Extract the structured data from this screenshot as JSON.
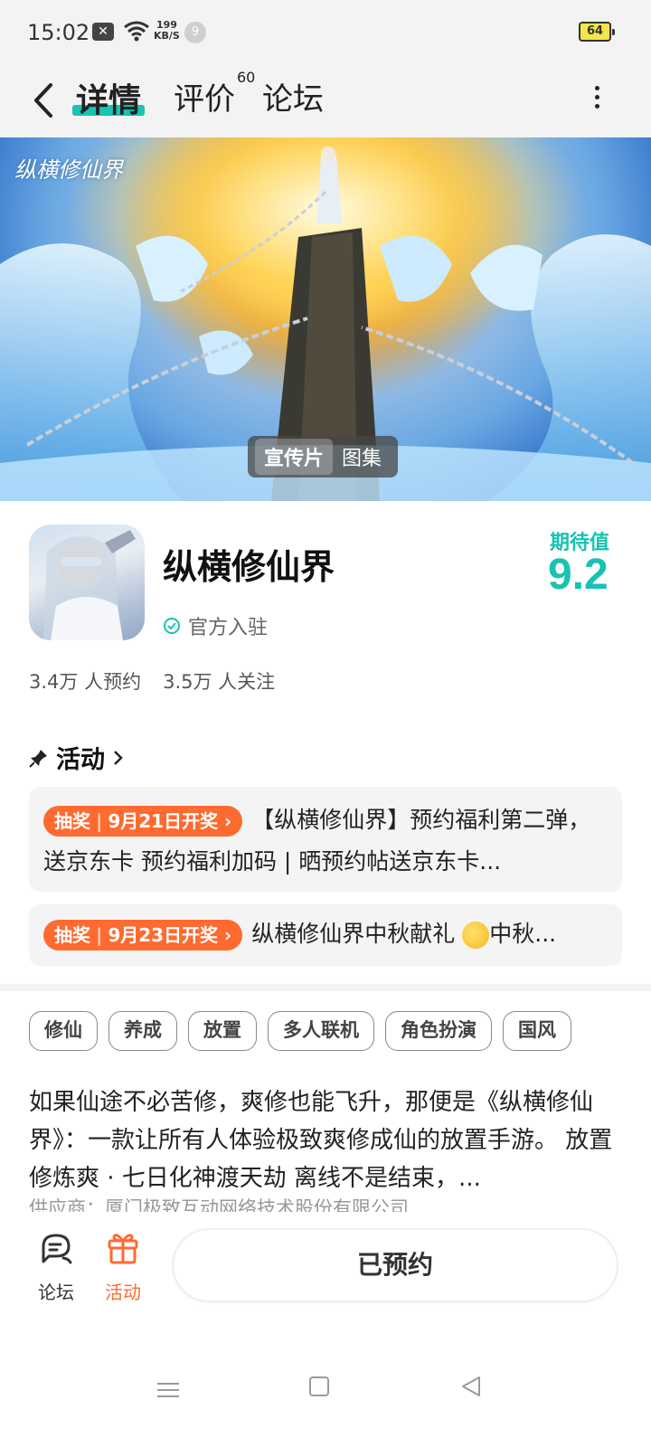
{
  "status_bar": {
    "time": "15:02",
    "net_speed_value": "199",
    "net_speed_unit": "KB/S",
    "notification_count": "9",
    "battery": "64"
  },
  "header": {
    "tabs": [
      {
        "label": "详情",
        "active": true
      },
      {
        "label": "评价",
        "count": "60"
      },
      {
        "label": "论坛"
      }
    ]
  },
  "banner": {
    "logo_text": "纵横修仙界",
    "media_tabs": [
      {
        "label": "宣传片",
        "active": true
      },
      {
        "label": "图集"
      }
    ]
  },
  "app": {
    "name": "纵横修仙界",
    "verified_label": "官方入驻",
    "score_label": "期待值",
    "score": "9.2",
    "reservations": "3.4万 人预约",
    "followers": "3.5万 人关注"
  },
  "activity": {
    "title": "活动",
    "items": [
      {
        "pill_type": "抽奖",
        "pill_date": "9月21日开奖",
        "text": "【纵横修仙界】预约福利第二弹，送京东卡 预约福利加码 | 晒预约帖送京东卡..."
      },
      {
        "pill_type": "抽奖",
        "pill_date": "9月23日开奖",
        "text": "纵横修仙界中秋献礼",
        "text_after": "中秋..."
      }
    ]
  },
  "tags": [
    "修仙",
    "养成",
    "放置",
    "多人联机",
    "角色扮演",
    "国风"
  ],
  "description": "如果仙途不必苦修，爽修也能飞升，那便是《纵横修仙界》：一款让所有人体验极致爽修成仙的放置手游。 放置修炼爽 · 七日化神渡天劫 离线不是结束，...",
  "supplier": "供应商：厦门极致互动网络技术股份有限公司",
  "bottom_bar": {
    "forum_label": "论坛",
    "activity_label": "活动",
    "reserve_button": "已预约"
  },
  "colors": {
    "accent": "#18c3b2",
    "activity_orange": "#ff6a30"
  }
}
